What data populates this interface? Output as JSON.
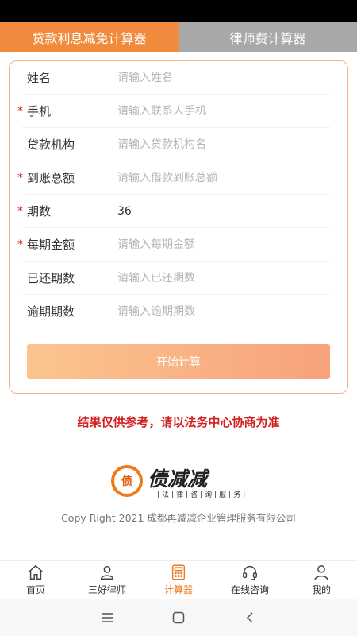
{
  "tabs": [
    {
      "label": "贷款利息减免计算器",
      "active": true
    },
    {
      "label": "律师费计算器",
      "active": false
    }
  ],
  "form": {
    "fields": [
      {
        "label": "姓名",
        "required": false,
        "value": "",
        "placeholder": "请输入姓名"
      },
      {
        "label": "手机",
        "required": true,
        "value": "",
        "placeholder": "请输入联系人手机"
      },
      {
        "label": "贷款机构",
        "required": false,
        "value": "",
        "placeholder": "请输入贷款机构名"
      },
      {
        "label": "到账总额",
        "required": true,
        "value": "",
        "placeholder": "请输入借款到账总额"
      },
      {
        "label": "期数",
        "required": true,
        "value": "36",
        "placeholder": ""
      },
      {
        "label": "每期金额",
        "required": true,
        "value": "",
        "placeholder": "请输入每期金额"
      },
      {
        "label": "已还期数",
        "required": false,
        "value": "",
        "placeholder": "请输入已还期数"
      },
      {
        "label": "逾期期数",
        "required": false,
        "value": "",
        "placeholder": "请输入逾期期数"
      }
    ],
    "required_mark": "*",
    "submit_label": "开始计算"
  },
  "disclaimer": "结果仅供参考，请以法务中心协商为准",
  "logo": {
    "mark": "债",
    "name": "债减减",
    "subtitle": "|法|律|咨|询|服|务|"
  },
  "copyright": "Copy Right 2021 成都再减减企业管理服务有限公司",
  "bottom_nav": [
    {
      "label": "首页",
      "icon": "home-icon",
      "active": false
    },
    {
      "label": "三好律师",
      "icon": "user-icon",
      "active": false
    },
    {
      "label": "计算器",
      "icon": "calculator-icon",
      "active": true
    },
    {
      "label": "在线咨询",
      "icon": "headset-icon",
      "active": false
    },
    {
      "label": "我的",
      "icon": "profile-icon",
      "active": false
    }
  ],
  "colors": {
    "accent": "#ef7a1e",
    "tab_inactive": "#a8a8a8",
    "disclaimer": "#d21f1f"
  }
}
